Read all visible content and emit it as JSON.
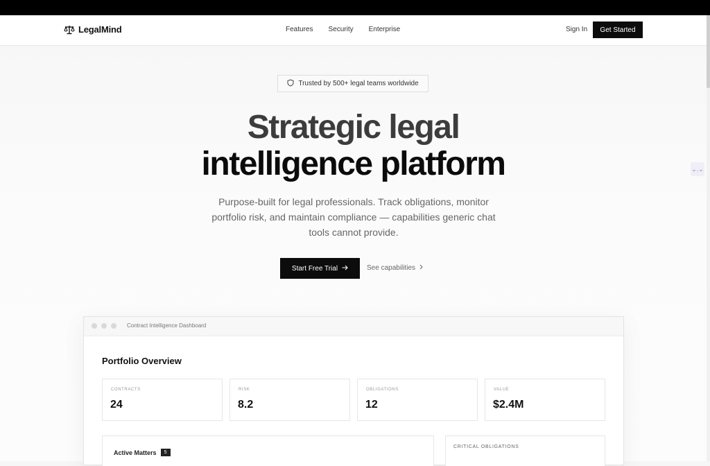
{
  "nav": {
    "brand": "LegalMind",
    "links": [
      "Features",
      "Security",
      "Enterprise"
    ],
    "sign_in": "Sign In",
    "get_started": "Get Started"
  },
  "hero": {
    "badge": "Trusted by 500+ legal teams worldwide",
    "headline_line1": "Strategic legal",
    "headline_line2": "intelligence platform",
    "subhead": "Purpose-built for legal professionals. Track obligations, monitor portfolio risk, and maintain compliance — capabilities generic chat tools cannot provide.",
    "cta_primary": "Start Free Trial",
    "cta_secondary": "See capabilities"
  },
  "dashboard": {
    "window_title": "Contract Intelligence Dashboard",
    "section_title": "Portfolio Overview",
    "metrics": [
      {
        "label": "CONTRACTS",
        "value": "24"
      },
      {
        "label": "RISK",
        "value": "8.2"
      },
      {
        "label": "OBLIGATIONS",
        "value": "12"
      },
      {
        "label": "VALUE",
        "value": "$2.4M"
      }
    ],
    "active_matters": {
      "label": "Active Matters",
      "count": "5"
    },
    "critical_obligations_label": "CRITICAL OBLIGATIONS"
  },
  "side_widget": "⌄.⌄",
  "icons": {
    "brand": "scales-icon",
    "badge": "shield-icon",
    "cta_primary": "arrow-right-icon",
    "cta_secondary": "chevron-right-icon"
  },
  "colors": {
    "primary": "#0c0c0c",
    "topbar": "#000000",
    "muted_text": "#666666"
  }
}
